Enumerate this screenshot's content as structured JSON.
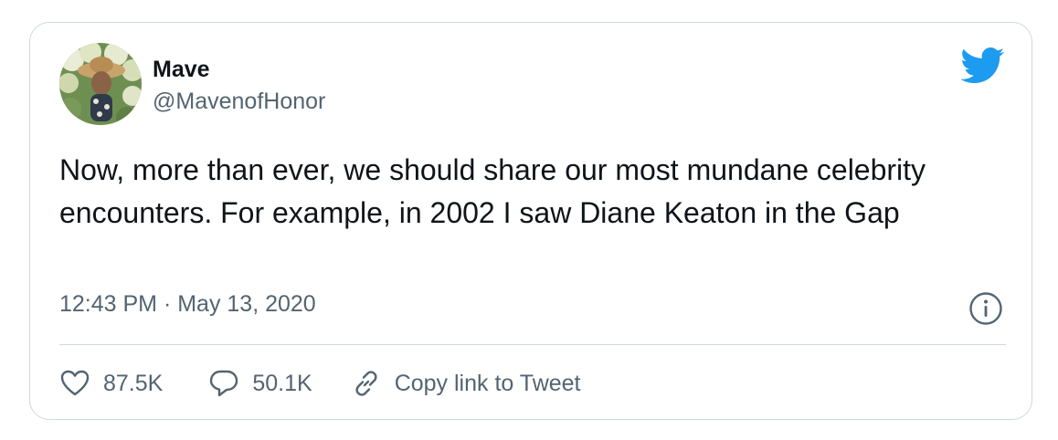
{
  "tweet": {
    "author": {
      "name": "Mave",
      "handle": "@MavenofHonor"
    },
    "text": "Now, more than ever, we should share our most mundane celebrity encounters. For example, in 2002 I saw Diane Keaton in the Gap",
    "timestamp": "12:43 PM · May 13, 2020"
  },
  "actions": {
    "like_count": "87.5K",
    "reply_count": "50.1K",
    "copy_link_label": "Copy link to Tweet"
  },
  "icons": {
    "brand": "twitter-bird-icon",
    "info": "info-icon",
    "like": "heart-icon",
    "reply": "speech-bubble-icon",
    "copy": "link-icon"
  },
  "colors": {
    "brand_blue": "#1d9bf0",
    "text": "#0f1419",
    "muted": "#536471",
    "border": "#cfd9de"
  }
}
